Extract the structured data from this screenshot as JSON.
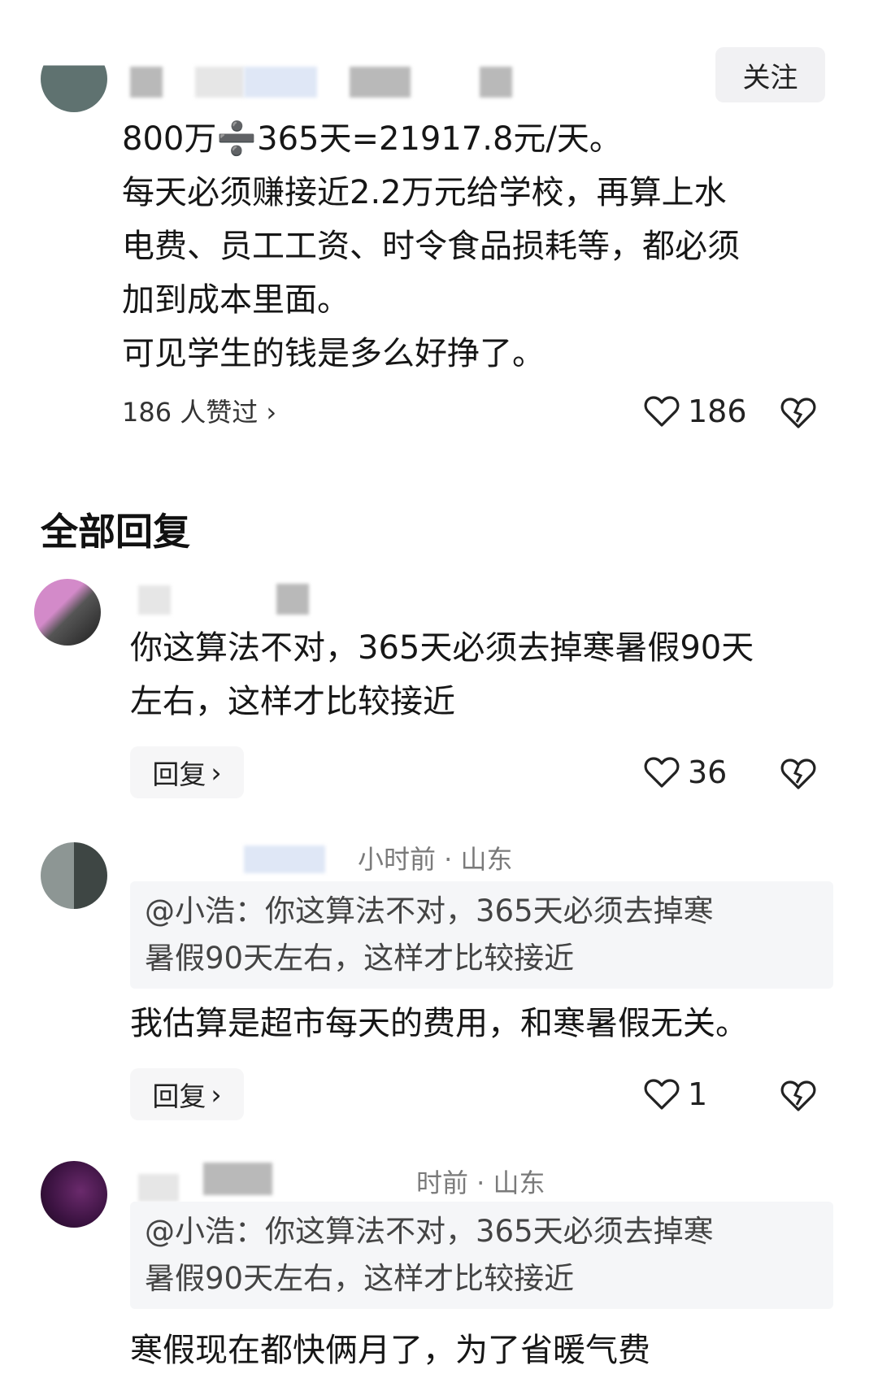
{
  "main_comment": {
    "follow_label": "关注",
    "lines": [
      "800万➗365天=21917.8元/天。",
      "每天必须赚接近2.2万元给学校，再算上水",
      "电费、员工工资、时令食品损耗等，都必须",
      "加到成本里面。",
      "可见学生的钱是多么好挣了。"
    ],
    "liked_by": "186 人赞过 ›",
    "like_count": "186"
  },
  "section_title": "全部回复",
  "replies": [
    {
      "lines": [
        "你这算法不对，365天必须去掉寒暑假90天",
        "左右，这样才比较接近"
      ],
      "reply_label": "回复",
      "like_count": "36"
    },
    {
      "meta": "小时前 · 山东",
      "quote_lines": [
        "@小浩：你这算法不对，365天必须去掉寒",
        "暑假90天左右，这样才比较接近"
      ],
      "lines": [
        "我估算是超市每天的费用，和寒暑假无关。"
      ],
      "reply_label": "回复",
      "like_count": "1"
    },
    {
      "meta": "时前 · 山东",
      "quote_lines": [
        "@小浩：你这算法不对，365天必须去掉寒",
        "暑假90天左右，这样才比较接近"
      ],
      "lines": [
        "寒假现在都快俩月了，为了省暖气费"
      ]
    }
  ]
}
